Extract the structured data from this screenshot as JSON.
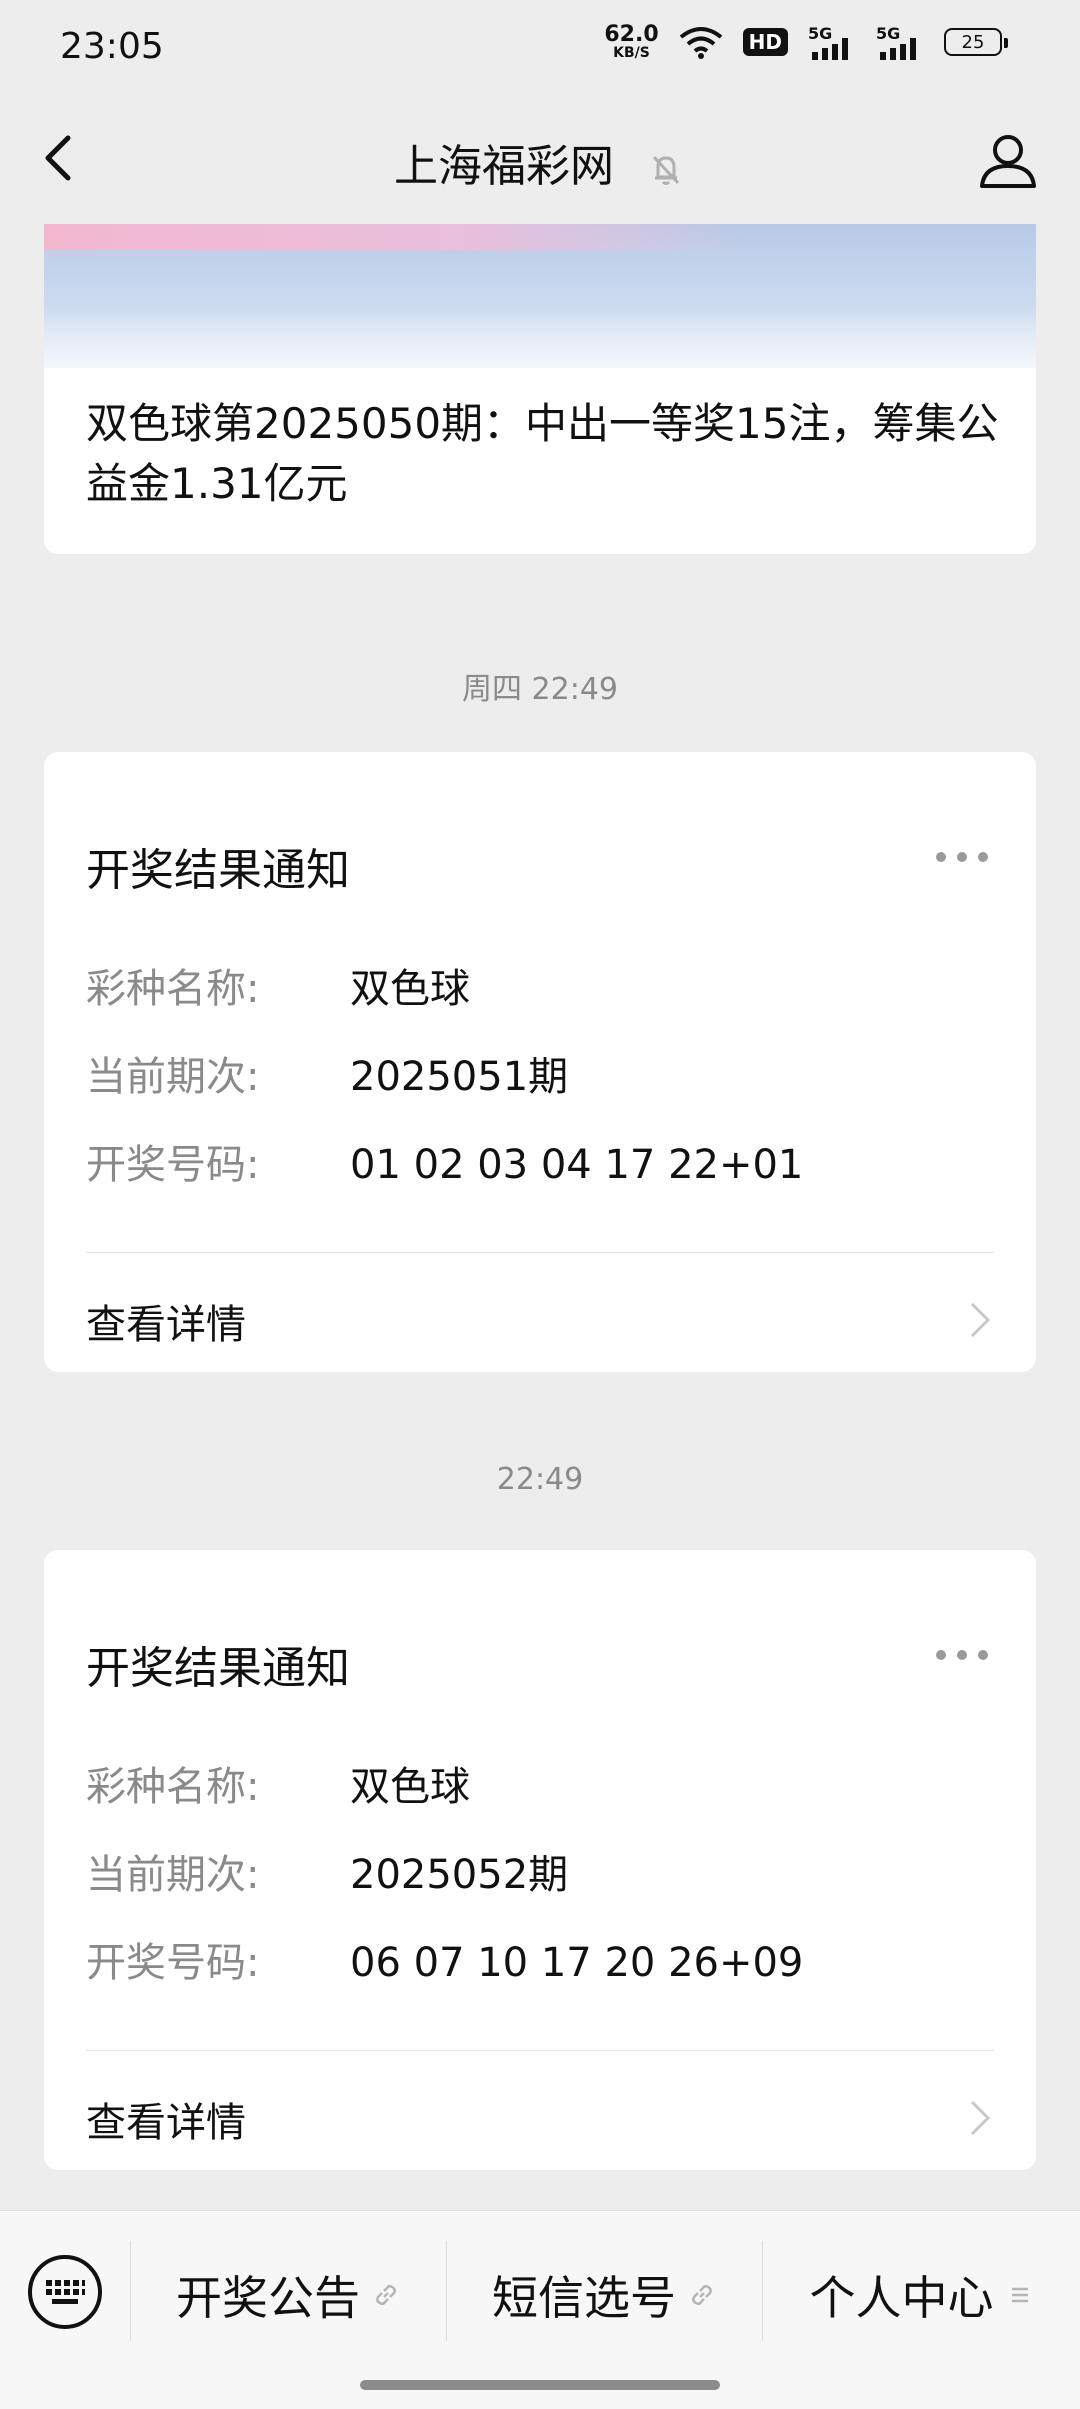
{
  "status_bar": {
    "time": "23:05",
    "net_speed_value": "62.0",
    "net_speed_unit": "KB/S",
    "hd_label": "HD",
    "signal_1_label": "5G",
    "signal_2_label": "5G",
    "battery": "25"
  },
  "header": {
    "title": "上海福彩网"
  },
  "article": {
    "title": "双色球第2025050期：中出一等奖15注，筹集公益金1.31亿元"
  },
  "messages": [
    {
      "timestamp": "周四 22:49",
      "title": "开奖结果通知",
      "rows": [
        {
          "key": "彩种名称:",
          "value": "双色球"
        },
        {
          "key": "当前期次:",
          "value": "2025051期"
        },
        {
          "key": "开奖号码:",
          "value": "01 02 03 04 17 22+01"
        }
      ],
      "detail_label": "查看详情"
    },
    {
      "timestamp": "22:49",
      "title": "开奖结果通知",
      "rows": [
        {
          "key": "彩种名称:",
          "value": "双色球"
        },
        {
          "key": "当前期次:",
          "value": "2025052期"
        },
        {
          "key": "开奖号码:",
          "value": "06 07 10 17 20 26+09"
        }
      ],
      "detail_label": "查看详情"
    }
  ],
  "bottom_menu": {
    "items": [
      {
        "label": "开奖公告",
        "icon": "link-icon"
      },
      {
        "label": "短信选号",
        "icon": "link-icon"
      },
      {
        "label": "个人中心",
        "icon": "menu-lines-icon"
      }
    ]
  },
  "colors": {
    "background": "#ededed",
    "card": "#ffffff",
    "muted_text": "#8a8a8a"
  }
}
